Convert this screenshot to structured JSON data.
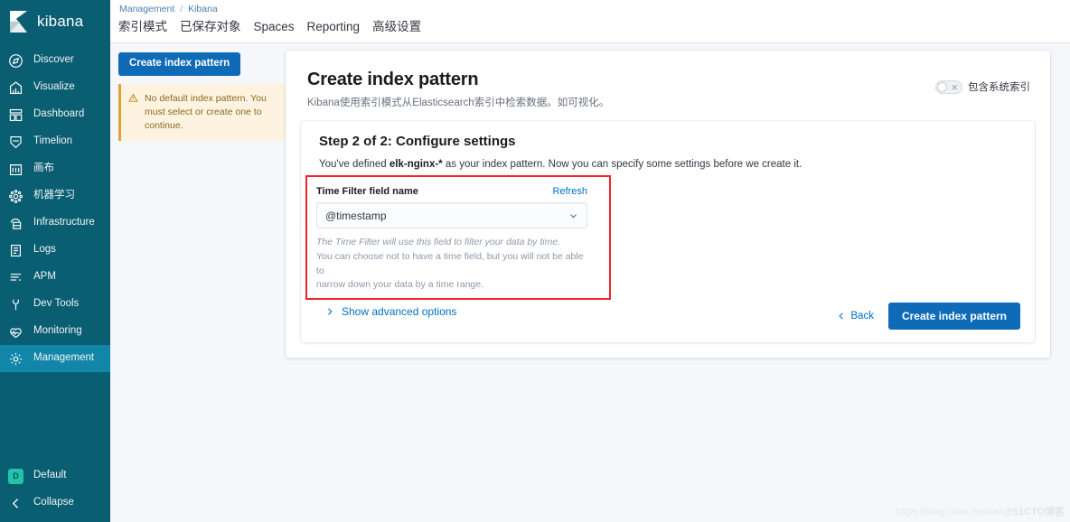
{
  "sidebar": {
    "brand": "kibana",
    "items": [
      {
        "label": "Discover",
        "icon": "compass-icon"
      },
      {
        "label": "Visualize",
        "icon": "bar-chart-icon"
      },
      {
        "label": "Dashboard",
        "icon": "dashboard-icon"
      },
      {
        "label": "Timelion",
        "icon": "timelion-icon"
      },
      {
        "label": "画布",
        "icon": "canvas-icon"
      },
      {
        "label": "机器学习",
        "icon": "machine-learning-icon"
      },
      {
        "label": "Infrastructure",
        "icon": "infrastructure-icon"
      },
      {
        "label": "Logs",
        "icon": "logs-icon"
      },
      {
        "label": "APM",
        "icon": "apm-icon"
      },
      {
        "label": "Dev Tools",
        "icon": "wrench-icon"
      },
      {
        "label": "Monitoring",
        "icon": "monitoring-icon"
      },
      {
        "label": "Management",
        "icon": "gear-icon",
        "active": true
      }
    ],
    "space": {
      "badge": "D",
      "label": "Default"
    },
    "collapse": {
      "label": "Collapse",
      "icon": "arrow-left-icon"
    }
  },
  "header": {
    "breadcrumb": {
      "root": "Management",
      "separator": "/",
      "current": "Kibana"
    },
    "tabs": [
      {
        "label": "索引模式"
      },
      {
        "label": "已保存对象"
      },
      {
        "label": "Spaces"
      },
      {
        "label": "Reporting"
      },
      {
        "label": "高级设置"
      }
    ]
  },
  "left_column": {
    "create_button": "Create index pattern",
    "callout": {
      "icon": "warning-icon",
      "text": "No default index pattern. You must select or create one to continue."
    }
  },
  "panel": {
    "title": "Create index pattern",
    "subtitle": "Kibana使用索引模式从Elasticsearch索引中检索数据。如可视化。",
    "system_indices_toggle": {
      "label": "包含系统索引",
      "state": "off",
      "off_glyph": "✕"
    }
  },
  "step": {
    "title": "Step 2 of 2: Configure settings",
    "description_prefix": "You've defined ",
    "index_pattern": "elk-nginx-*",
    "description_suffix": " as your index pattern. Now you can specify some settings before we create it.",
    "time_filter": {
      "label": "Time Filter field name",
      "refresh_link": "Refresh",
      "selected_value": "@timestamp",
      "caret_icon": "chevron-down-icon",
      "help_line_1": "The Time Filter will use this field to filter your data by time.",
      "help_line_2": "You can choose not to have a time field, but you will not be able to",
      "help_line_3": "narrow down your data by a time range."
    },
    "advanced": {
      "label": "Show advanced options",
      "icon": "chevron-right-icon"
    }
  },
  "actions": {
    "back": {
      "label": "Back",
      "icon": "chevron-left-icon"
    },
    "create": {
      "label": "Create index pattern"
    }
  },
  "watermark": {
    "url": "https://blog.csdn.net/wei",
    "site": "@51CTO博客"
  },
  "colors": {
    "sidebar_bg": "#0a5e72",
    "sidebar_active": "#1286a8",
    "primary_button": "#0f6bb8",
    "link": "#0071c2",
    "highlight_box": "#f5222d",
    "callout_bg": "#fdf3e0",
    "callout_border": "#e0a43a",
    "space_badge": "#24c2ab",
    "page_bg": "#f5f7fa"
  }
}
